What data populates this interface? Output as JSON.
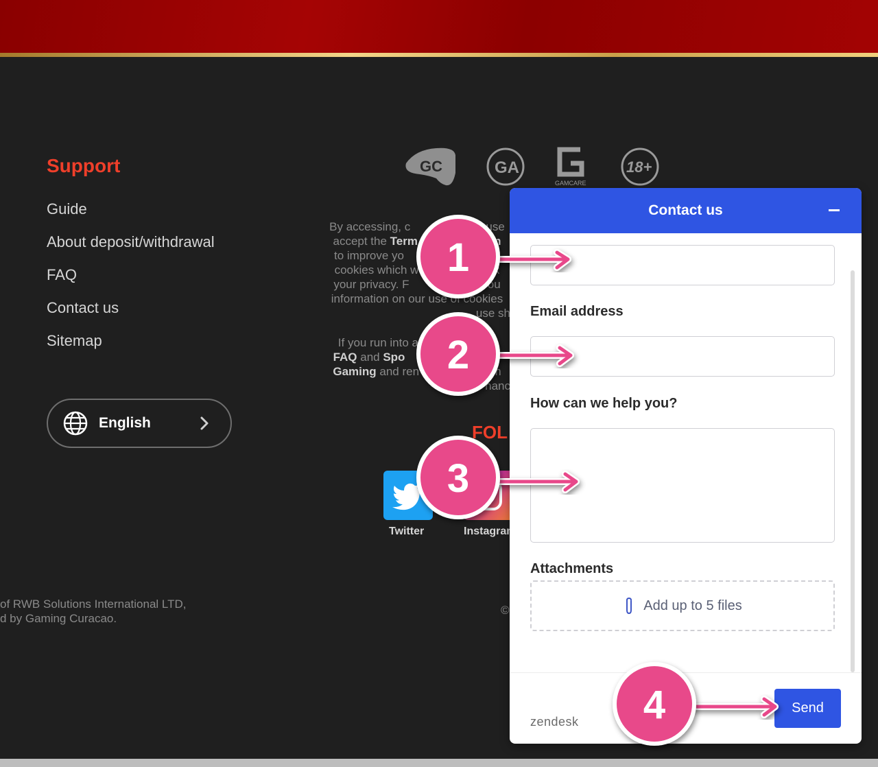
{
  "support": {
    "title": "Support",
    "items": [
      "Guide",
      "About deposit/withdrawal",
      "FAQ",
      "Contact us",
      "Sitemap"
    ]
  },
  "language": {
    "label": "English",
    "icon": "globe-icon"
  },
  "badges": [
    "GC",
    "GA",
    "GAMCARE",
    "18+"
  ],
  "disclaimer": {
    "p1": [
      {
        "t": "By accessing, c",
        "b": false
      },
      {
        "t": "o use",
        "b": false
      },
      {
        "t": "accept the ",
        "b": false
      },
      {
        "t": "Term",
        "b": true
      },
      {
        "t": "ion",
        "b": true
      },
      {
        "t": "to improve yo",
        "b": false
      },
      {
        "t": "cookies which w",
        "b": false
      },
      {
        "t": "ex",
        "b": false
      },
      {
        "t": "your privacy. F",
        "b": false
      },
      {
        "t": "o ou",
        "b": false
      },
      {
        "t": "information on our use of cookies",
        "b": false
      },
      {
        "t": "use sh",
        "b": false
      }
    ],
    "p2": [
      {
        "t": "If you run into a",
        "b": false
      },
      {
        "t": "hi",
        "b": false
      },
      {
        "t": "FAQ",
        "b": true
      },
      {
        "t": " and ",
        "b": false
      },
      {
        "t": "Spo",
        "b": true
      },
      {
        "t": "Gaming",
        "b": true
      },
      {
        "t": " and ren",
        "b": false
      },
      {
        "t": "am",
        "b": false
      },
      {
        "t": "nanc",
        "b": false
      }
    ]
  },
  "follow_label": "FOL",
  "social": [
    {
      "name": "Twitter",
      "icon": "twitter-icon",
      "color": "#1da1f2"
    },
    {
      "name": "Instagram",
      "icon": "instagram-icon"
    }
  ],
  "legal": {
    "line1": "of RWB Solutions International LTD,",
    "line2": "d by Gaming Curacao.",
    "copyright_fragment": "©"
  },
  "widget": {
    "title": "Contact us",
    "email_label": "Email address",
    "help_label": "How can we help you?",
    "attachments_label": "Attachments",
    "attach_text": "Add up to 5 files",
    "send_label": "Send",
    "brand": "zendesk",
    "accent": "#2f55e3"
  },
  "callouts": [
    {
      "number": "1"
    },
    {
      "number": "2"
    },
    {
      "number": "3"
    },
    {
      "number": "4"
    }
  ],
  "colors": {
    "topbar": "#a50404",
    "background": "#1f1f1f",
    "support_heading": "#ef3f2a",
    "callout": "#e8488a"
  }
}
